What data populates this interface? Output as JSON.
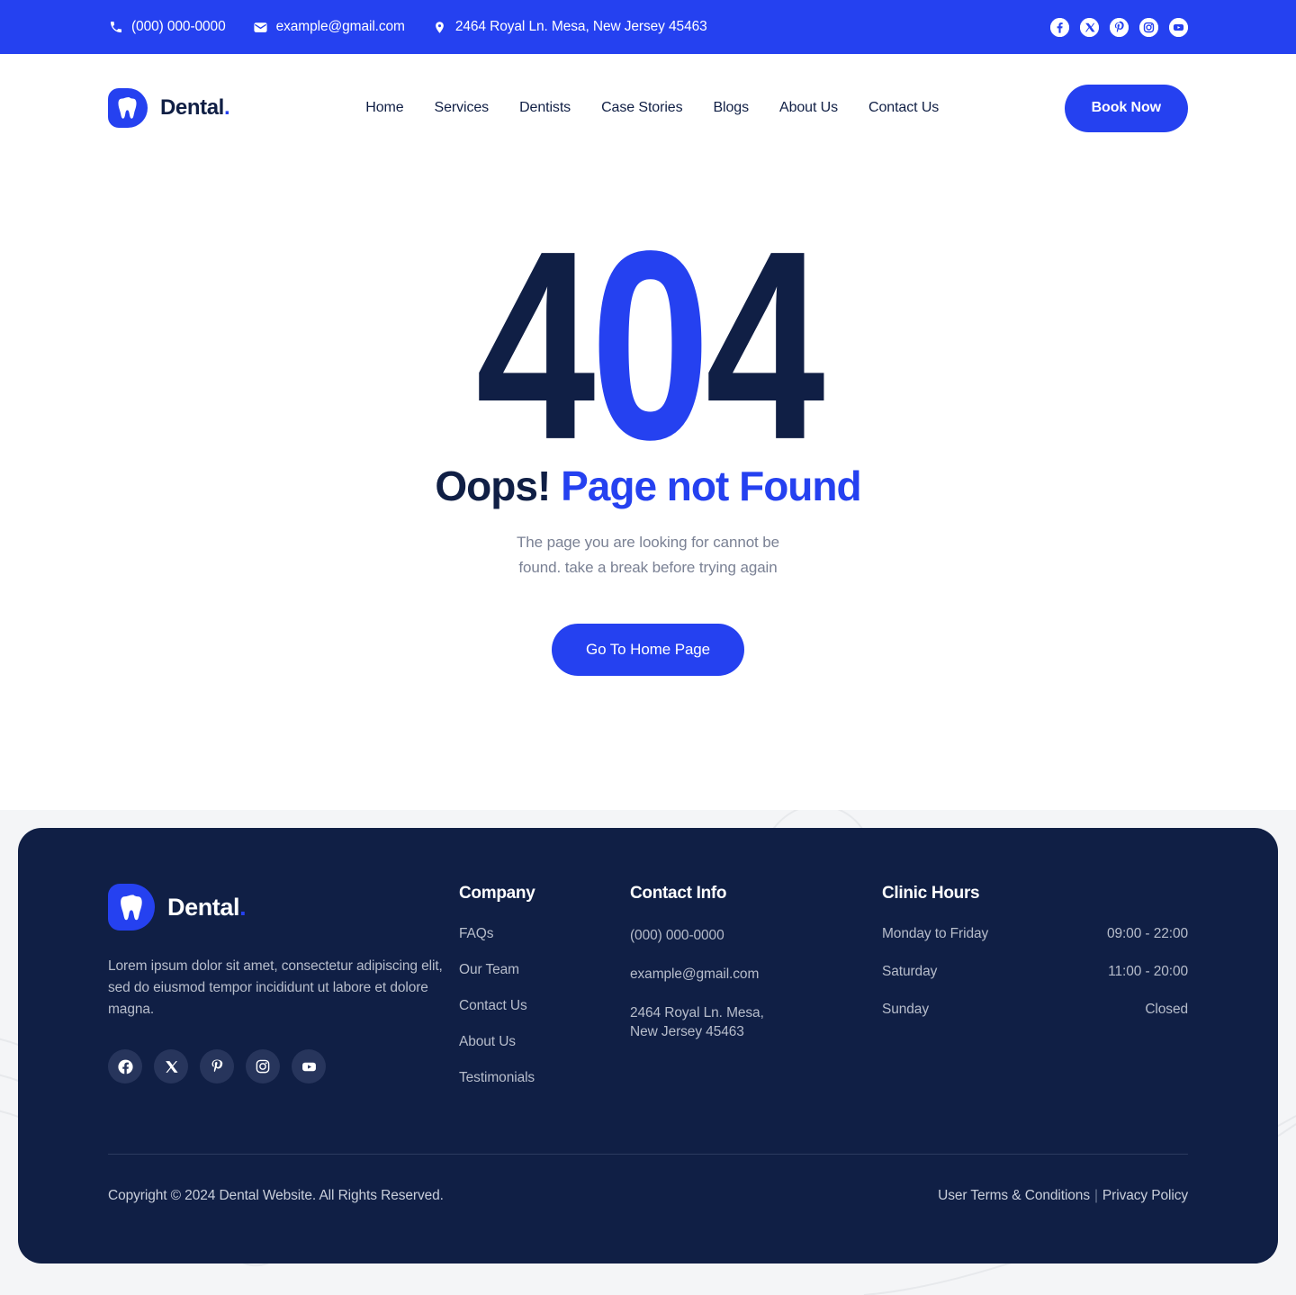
{
  "topbar": {
    "phone": "(000) 000-0000",
    "email": "example@gmail.com",
    "address": "2464 Royal Ln. Mesa, New Jersey 45463",
    "socials": [
      "facebook-icon",
      "x-twitter-icon",
      "pinterest-icon",
      "instagram-icon",
      "youtube-icon"
    ]
  },
  "nav": {
    "brand": "Dental",
    "brand_dot": ".",
    "links": [
      {
        "label": "Home"
      },
      {
        "label": "Services"
      },
      {
        "label": "Dentists"
      },
      {
        "label": "Case Stories"
      },
      {
        "label": "Blogs"
      },
      {
        "label": "About Us"
      },
      {
        "label": "Contact Us"
      }
    ],
    "cta": "Book Now"
  },
  "hero": {
    "code_a": "4",
    "code_b": "0",
    "code_c": "4",
    "title_dark": "Oops!",
    "title_accent": "Page not Found",
    "subtitle_line1": "The page you are looking for cannot be",
    "subtitle_line2": "found. take a break before trying again",
    "button": "Go To Home Page"
  },
  "footer": {
    "brand": "Dental",
    "brand_dot": ".",
    "description": "Lorem ipsum dolor sit amet, consectetur adipiscing elit, sed do eiusmod tempor incididunt ut labore et dolore magna.",
    "socials": [
      "facebook-icon",
      "x-twitter-icon",
      "pinterest-icon",
      "instagram-icon",
      "youtube-icon"
    ],
    "company": {
      "title": "Company",
      "links": [
        {
          "label": "FAQs"
        },
        {
          "label": "Our Team"
        },
        {
          "label": "Contact Us"
        },
        {
          "label": "About Us"
        },
        {
          "label": "Testimonials"
        }
      ]
    },
    "contact": {
      "title": "Contact Info",
      "phone": "(000) 000-0000",
      "email": "example@gmail.com",
      "address_line1": "2464 Royal Ln. Mesa,",
      "address_line2": "New Jersey 45463"
    },
    "hours": {
      "title": "Clinic Hours",
      "rows": [
        {
          "day": "Monday to Friday",
          "time": "09:00 - 22:00"
        },
        {
          "day": "Saturday",
          "time": "11:00 - 20:00"
        },
        {
          "day": "Sunday",
          "time": "Closed"
        }
      ]
    },
    "copyright": "Copyright © 2024 Dental Website. All Rights Reserved.",
    "terms": "User Terms & Conditions",
    "separator": "|",
    "privacy": "Privacy Policy"
  },
  "colors": {
    "brand_blue": "#2541f0",
    "navy": "#101f45",
    "muted": "#7a8194",
    "footer_muted": "#b7bdcb",
    "page_bg_lower": "#f4f5f7"
  }
}
